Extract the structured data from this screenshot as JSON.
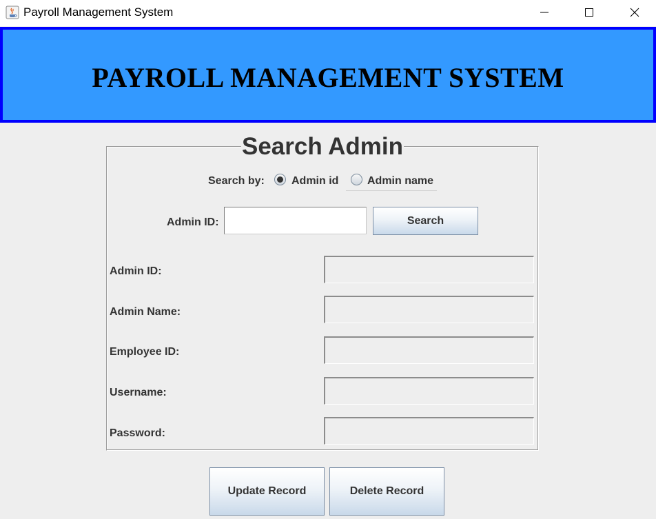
{
  "window": {
    "title": "Payroll Management System",
    "icons": [
      "java-app-icon",
      "minimize-icon",
      "maximize-icon",
      "close-icon"
    ]
  },
  "banner": {
    "title": "PAYROLL MANAGEMENT SYSTEM",
    "background_color": "#3399ff",
    "border_color": "#0000ff"
  },
  "panel": {
    "title": "Search Admin",
    "search_by_label": "Search by:",
    "radio_options": [
      {
        "label": "Admin id",
        "selected": true
      },
      {
        "label": "Admin name",
        "selected": false
      }
    ],
    "search_field_label": "Admin ID:",
    "search_field_value": "",
    "search_button": "Search",
    "fields": [
      {
        "label": "Admin ID:",
        "value": ""
      },
      {
        "label": "Admin Name:",
        "value": ""
      },
      {
        "label": "Employee ID:",
        "value": ""
      },
      {
        "label": "Username:",
        "value": ""
      },
      {
        "label": "Password:",
        "value": ""
      }
    ]
  },
  "actions": {
    "update_label": "Update Record",
    "delete_label": "Delete Record"
  }
}
